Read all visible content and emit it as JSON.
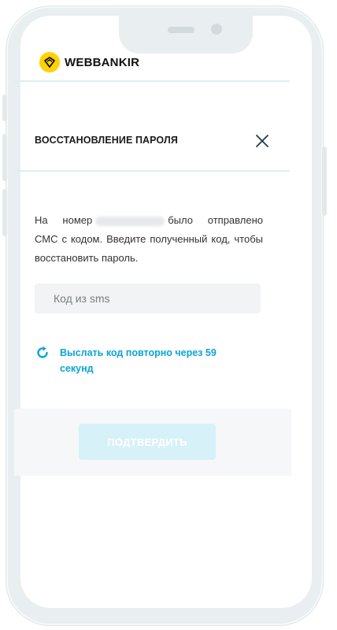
{
  "brand": {
    "name": "WEBBANKIR",
    "accent": "#ffd200"
  },
  "modal": {
    "title": "ВОССТАНОВЛЕНИЕ ПАРОЛЯ",
    "close_icon": "close-icon",
    "message_before": "На номер",
    "message_after": "было отправлено СМС с кодом. Введите полученный код, чтобы восстановить пароль.",
    "code_placeholder": "Код из sms",
    "resend_text": "Выслать код повторно через 59 секунд",
    "resend_icon": "refresh-icon",
    "confirm_label": "ПОДТВЕРДИТЬ"
  },
  "colors": {
    "link": "#0aa4d6",
    "button_disabled": "#d7f1f8",
    "divider": "#dbeef3"
  }
}
